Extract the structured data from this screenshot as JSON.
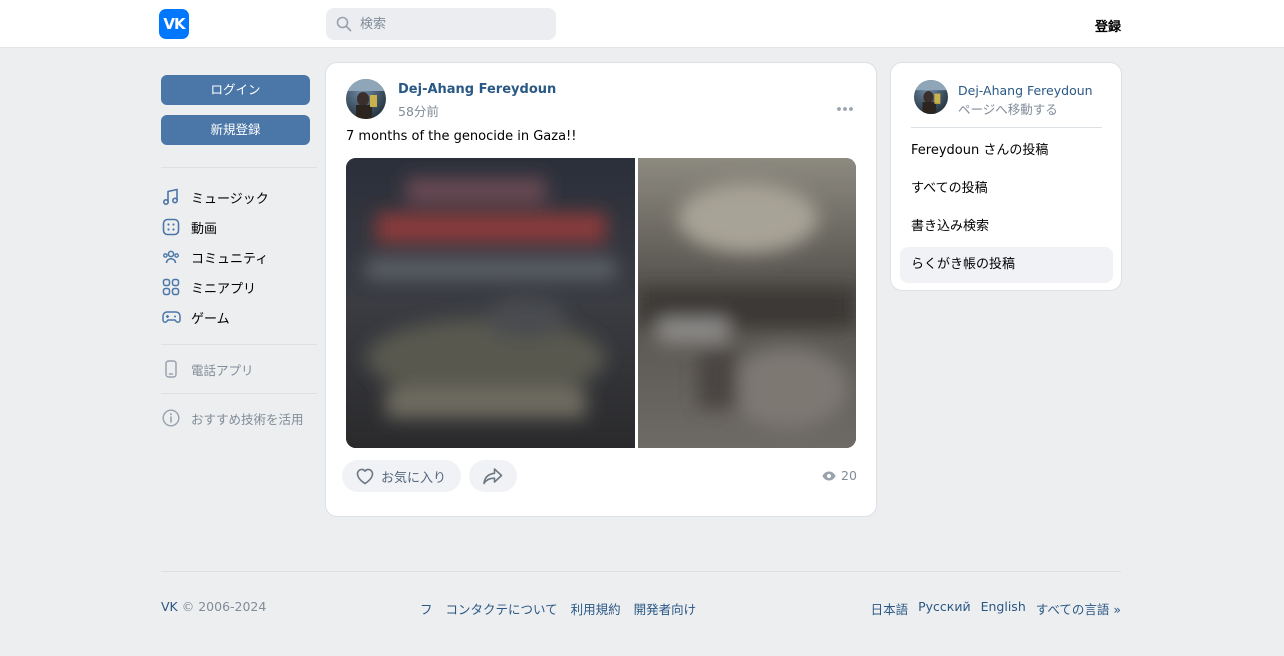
{
  "header": {
    "logo_text": "VK",
    "search_placeholder": "検索",
    "register_label": "登録"
  },
  "left_nav": {
    "login_label": "ログイン",
    "signup_label": "新規登録",
    "items": [
      {
        "label": "ミュージック",
        "icon": "music-icon"
      },
      {
        "label": "動画",
        "icon": "video-icon"
      },
      {
        "label": "コミュニティ",
        "icon": "community-icon"
      },
      {
        "label": "ミニアプリ",
        "icon": "mini-apps-icon"
      },
      {
        "label": "ゲーム",
        "icon": "gamepad-icon"
      }
    ],
    "phone_app_label": "電話アプリ",
    "recommend_label": "おすすめ技術を活用"
  },
  "post": {
    "author": "Dej-Ahang Fereydoun",
    "time": "58分前",
    "text": "7 months of the genocide in Gaza!!",
    "like_label": "お気に入り",
    "views": "20"
  },
  "sidebar": {
    "name": "Dej-Ahang Fereydoun",
    "subtitle": "ページへ移動する",
    "items": [
      {
        "label": "Fereydoun さんの投稿"
      },
      {
        "label": "すべての投稿"
      },
      {
        "label": "書き込み検索"
      },
      {
        "label": "らくがき帳の投稿"
      }
    ]
  },
  "footer": {
    "copyright": "© 2006-2024",
    "brand": "VK",
    "links": [
      "フ",
      "コンタクテについて",
      "利用規約",
      "開発者向け"
    ],
    "languages": [
      "日本語",
      "Русский",
      "English",
      "すべての言語 »"
    ]
  },
  "colors": {
    "brand": "#0077ff",
    "button": "#4a76a8",
    "link": "#2a5885",
    "muted": "#818c99",
    "background": "#edeef0"
  }
}
